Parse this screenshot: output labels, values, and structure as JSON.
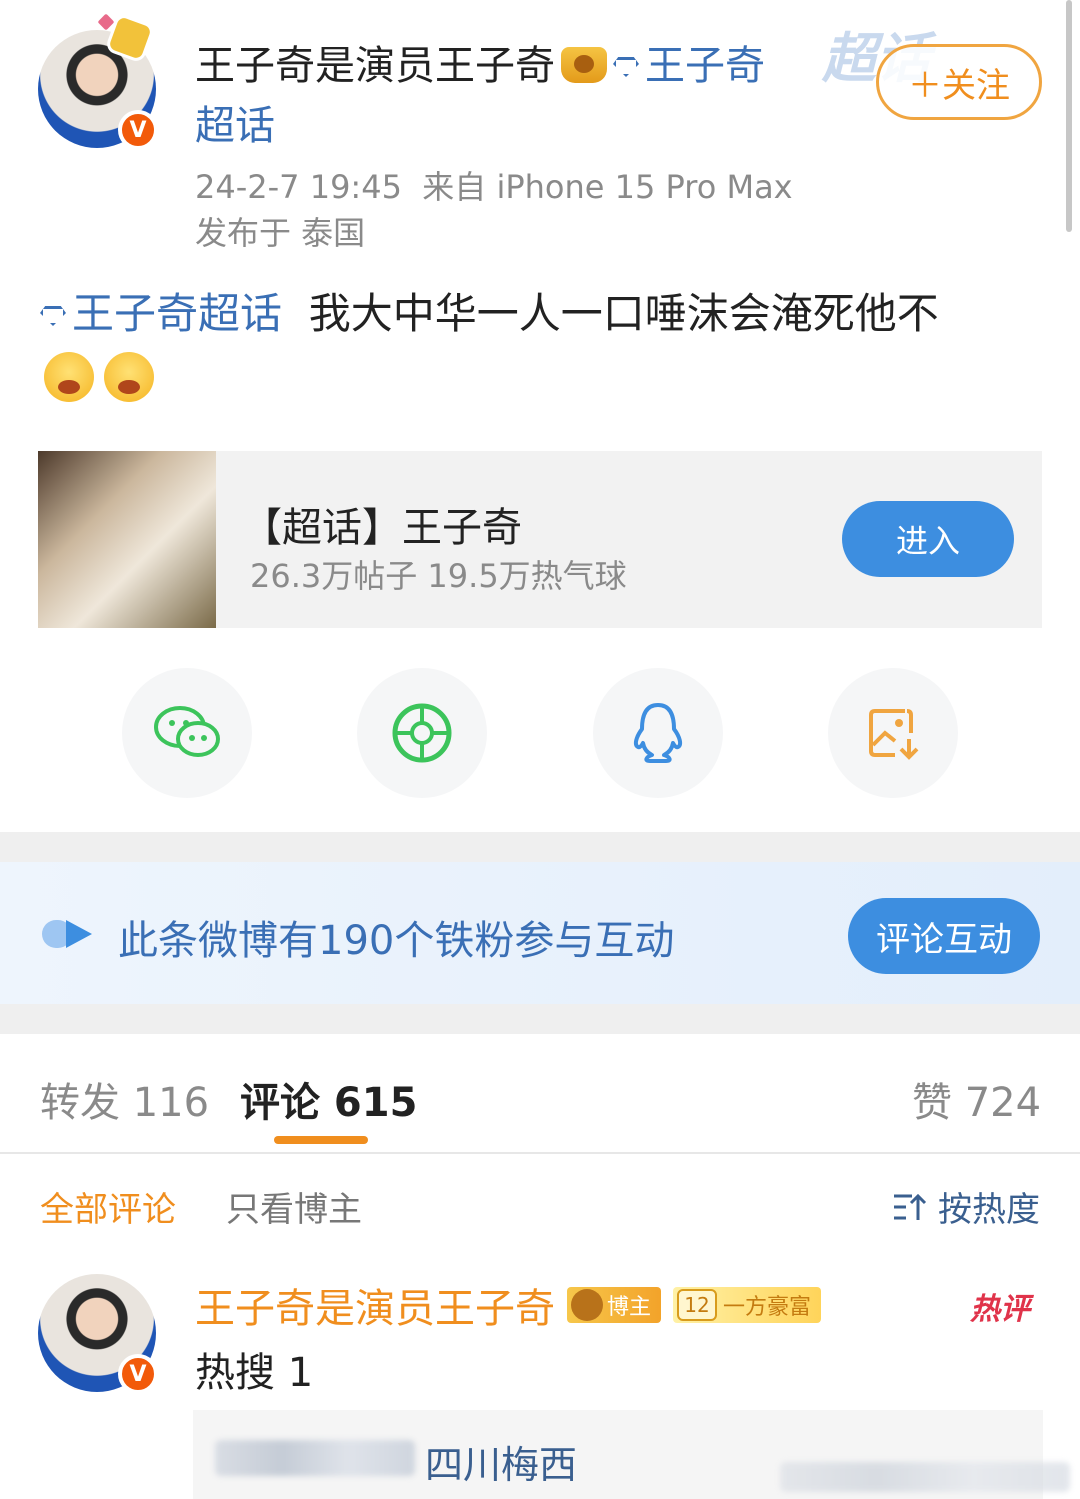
{
  "post": {
    "author": "王子奇是演员王子奇",
    "author_badge_icon": "crown-badge-icon",
    "topic_link": "王子奇",
    "topic_link_suffix": "超话",
    "watermark": "超话",
    "follow_label": "＋关注",
    "timestamp": "24-2-7 19:45",
    "source": "来自 iPhone 15 Pro Max",
    "location": "发布于 泰国",
    "text_topic": "王子奇超话",
    "text_body": "我大中华一人一口唾沫会淹死他不",
    "emojis": [
      "angry-emoji",
      "angry-emoji"
    ]
  },
  "topic_card": {
    "title": "【超话】王子奇",
    "stats": "26.3万帖子 19.5万热气球",
    "enter_label": "进入"
  },
  "share": {
    "items": [
      {
        "name": "wechat",
        "icon": "wechat-icon",
        "color": "#3cc45b"
      },
      {
        "name": "moments",
        "icon": "moments-icon",
        "color": "#3cc45b"
      },
      {
        "name": "qq",
        "icon": "qq-icon",
        "color": "#3d8ee0"
      },
      {
        "name": "save-image",
        "icon": "save-image-icon",
        "color": "#f0a540"
      }
    ]
  },
  "fans_banner": {
    "text": "此条微博有190个铁粉参与互动",
    "button_label": "评论互动"
  },
  "tabs": {
    "repost": "转发 116",
    "comment": "评论 615",
    "like": "赞 724"
  },
  "filters": {
    "all": "全部评论",
    "author_only": "只看博主",
    "sort": "按热度"
  },
  "comment": {
    "author": "王子奇是演员王子奇",
    "badge_bozhu": "博主",
    "badge_level_num": "12",
    "badge_level_text": "一方豪富",
    "hot_tag": "热评",
    "text": "热搜 1",
    "reply_text": "四川梅西"
  },
  "colors": {
    "accent_orange": "#f08e1e",
    "link_blue": "#3a6fb5",
    "button_blue": "#3d8ee0"
  }
}
